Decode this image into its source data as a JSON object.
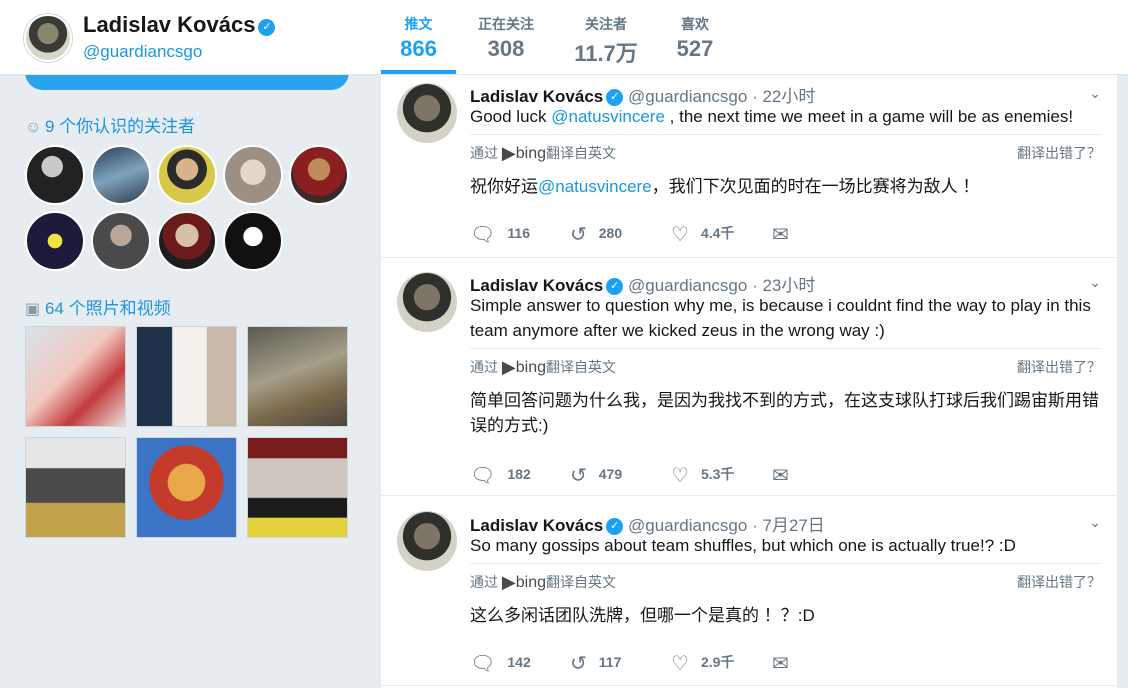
{
  "profile": {
    "name": "Ladislav Kovács",
    "handle": "@guardiancsgo"
  },
  "stats": [
    {
      "label": "推文",
      "value": "866"
    },
    {
      "label": "正在关注",
      "value": "308"
    },
    {
      "label": "关注者",
      "value": "11.7万"
    },
    {
      "label": "喜欢",
      "value": "527"
    }
  ],
  "sidebar": {
    "followers_you_know": "9 个你认识的关注者",
    "photos_videos": "64 个照片和视频"
  },
  "translate": {
    "via": "通过",
    "bing": "bing",
    "from": "翻译自英文",
    "wrong": "翻译出错了？"
  },
  "tweets": [
    {
      "name": "Ladislav Kovács",
      "handle": "@guardiancsgo",
      "time": "· 22小时",
      "text_before": "Good luck ",
      "mention": "@natusvincere",
      "text_after": " , the next time we meet in a game will be as enemies!",
      "trans_before": "祝你好运",
      "trans_mention": "@natusvincere",
      "trans_after": "，我们下次见面的时在一场比赛将为敌人 ！",
      "replies": "116",
      "retweets": "280",
      "likes": "4.4千"
    },
    {
      "name": "Ladislav Kovács",
      "handle": "@guardiancsgo",
      "time": "· 23小时",
      "text": "Simple answer to question why me, is because i couldnt find the way to play in this team anymore after we kicked zeus in the wrong way :)",
      "translation": "简单回答问题为什么我，是因为我找不到的方式，在这支球队打球后我们踢宙斯用错误的方式:)",
      "replies": "182",
      "retweets": "479",
      "likes": "5.3千"
    },
    {
      "name": "Ladislav Kovács",
      "handle": "@guardiancsgo",
      "time": "· 7月27日",
      "text": "So many gossips about team shuffles, but which one is actually true!? :D",
      "translation": "这么多闲话团队洗牌，但哪一个是真的 ！？:D",
      "replies": "142",
      "retweets": "117",
      "likes": "2.9千"
    }
  ],
  "colors": {
    "accent": "#1da1f2",
    "link": "#1b95e0",
    "background": "#e6ecf0"
  }
}
